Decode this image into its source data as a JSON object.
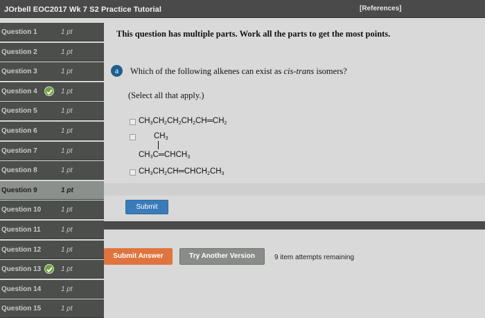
{
  "header": {
    "title": "JOrbell EOC2017 Wk 7 S2 Practice Tutorial",
    "references": "[References]"
  },
  "sidebar": {
    "items": [
      {
        "label": "Question 1",
        "points": "1 pt",
        "completed": false,
        "active": false
      },
      {
        "label": "Question 2",
        "points": "1 pt",
        "completed": false,
        "active": false
      },
      {
        "label": "Question 3",
        "points": "1 pt",
        "completed": false,
        "active": false
      },
      {
        "label": "Question 4",
        "points": "1 pt",
        "completed": true,
        "active": false
      },
      {
        "label": "Question 5",
        "points": "1 pt",
        "completed": false,
        "active": false
      },
      {
        "label": "Question 6",
        "points": "1 pt",
        "completed": false,
        "active": false
      },
      {
        "label": "Question 7",
        "points": "1 pt",
        "completed": false,
        "active": false
      },
      {
        "label": "Question 8",
        "points": "1 pt",
        "completed": false,
        "active": false
      },
      {
        "label": "Question 9",
        "points": "1 pt",
        "completed": false,
        "active": true
      },
      {
        "label": "Question 10",
        "points": "1 pt",
        "completed": false,
        "active": false
      },
      {
        "label": "Question 11",
        "points": "1 pt",
        "completed": false,
        "active": false
      },
      {
        "label": "Question 12",
        "points": "1 pt",
        "completed": false,
        "active": false
      },
      {
        "label": "Question 13",
        "points": "1 pt",
        "completed": true,
        "active": false
      },
      {
        "label": "Question 14",
        "points": "1 pt",
        "completed": false,
        "active": false
      },
      {
        "label": "Question 15",
        "points": "1 pt",
        "completed": false,
        "active": false
      }
    ]
  },
  "main": {
    "intro": "This question has multiple parts. Work all the parts to get the most points.",
    "part_label": "a",
    "question_prefix": "Which of the following alkenes can exist as ",
    "question_emphasis": "cis-trans",
    "question_suffix": " isomers?",
    "instruction": "(Select all that apply.)",
    "options": {
      "opt1": {
        "parts": [
          "CH",
          "3",
          "CH",
          "2",
          "CH",
          "2",
          "CH",
          "2",
          "CH",
          "=",
          "CH",
          "2"
        ]
      },
      "opt2": {
        "top": {
          "parts": [
            "CH",
            "3"
          ]
        },
        "bottom": {
          "parts": [
            "CH",
            "3",
            "C",
            "=",
            "CHCH",
            "3"
          ]
        }
      },
      "opt3": {
        "parts": [
          "CH",
          "3",
          "CH",
          "2",
          "CH",
          "=",
          "CHCH",
          "2",
          "CH",
          "3"
        ]
      }
    },
    "submit_label": "Submit",
    "submit_answer_label": "Submit Answer",
    "try_another_label": "Try Another Version",
    "attempts_text": "9 item attempts remaining"
  },
  "colors": {
    "topbar": "#4a4a4a",
    "sidebar": "#4b4e4b",
    "active_item": "#8c908c",
    "check": "#6fa33f",
    "submit": "#3b7bb8",
    "submit_answer": "#e0743f",
    "try_another": "#8a8c8a",
    "part_badge": "#1f5e8e"
  },
  "icons": {
    "completed": "check-circle-icon",
    "checkbox": "checkbox-icon"
  }
}
